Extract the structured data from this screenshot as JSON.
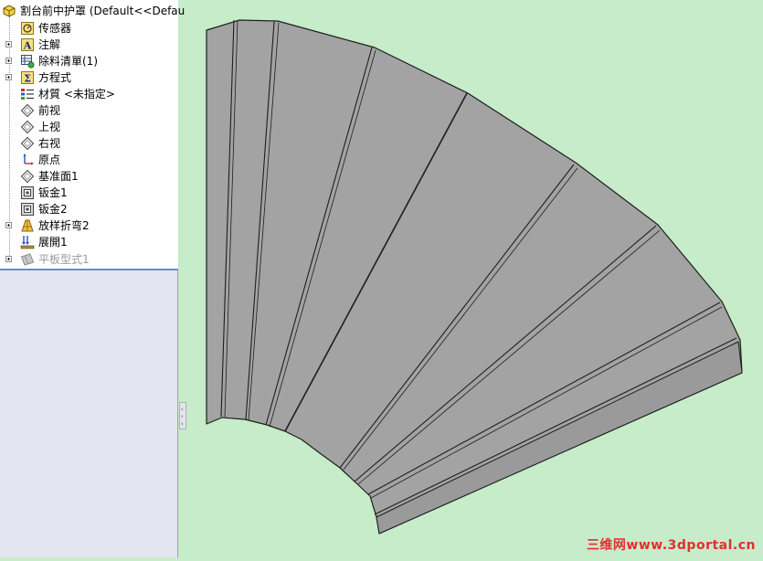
{
  "tree": {
    "root_label": "割台前中护罩 (Default<<Defau",
    "items": [
      {
        "label": "传感器",
        "icon": "sensor-icon",
        "expandable": false
      },
      {
        "label": "注解",
        "icon": "annotation-icon",
        "expandable": true
      },
      {
        "label": "除料清單(1)",
        "icon": "cut-list-icon",
        "expandable": true
      },
      {
        "label": "方程式",
        "icon": "equation-icon",
        "expandable": true
      },
      {
        "label": "材質 <未指定>",
        "icon": "material-icon",
        "expandable": false
      },
      {
        "label": "前视",
        "icon": "plane-icon",
        "expandable": false
      },
      {
        "label": "上视",
        "icon": "plane-icon",
        "expandable": false
      },
      {
        "label": "右视",
        "icon": "plane-icon",
        "expandable": false
      },
      {
        "label": "原点",
        "icon": "origin-icon",
        "expandable": false
      },
      {
        "label": "基准面1",
        "icon": "plane-icon",
        "expandable": false
      },
      {
        "label": "钣金1",
        "icon": "sheet-metal-icon",
        "expandable": false
      },
      {
        "label": "钣金2",
        "icon": "sheet-metal-icon",
        "expandable": false
      },
      {
        "label": "放样折弯2",
        "icon": "lofted-bend-icon",
        "expandable": true
      },
      {
        "label": "展開1",
        "icon": "flatten-icon",
        "expandable": false
      },
      {
        "label": "平板型式1",
        "icon": "flat-pattern-icon",
        "expandable": true,
        "suppressed": true
      }
    ]
  },
  "watermark": "三维网www.3dportal.cn",
  "colors": {
    "viewport_bg": "#c6ecc9",
    "part_face": "#a3a3a3",
    "edge": "#1e1e1e",
    "watermark": "#e03030"
  }
}
